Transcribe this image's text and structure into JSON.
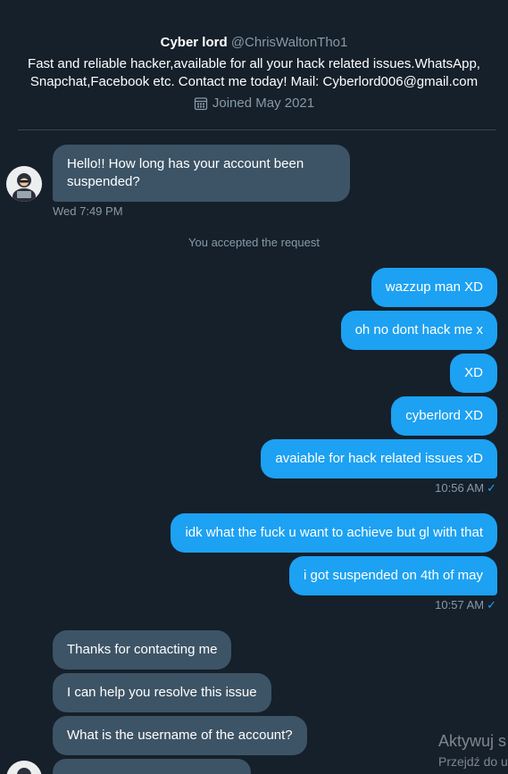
{
  "profile": {
    "name": "Cyber lord",
    "handle": "@ChrisWaltonTho1",
    "bio": "Fast and reliable hacker,available for all your hack related issues.WhatsApp, Snapchat,Facebook etc. Contact me today! Mail: Cyberlord006@gmail.com",
    "joined": "Joined May 2021",
    "joined_icon": "calendar-icon"
  },
  "conversation": {
    "first_message": "Hello!! How long has your account been suspended?",
    "first_time": "Wed 7:49 PM",
    "system_note": "You accepted the request",
    "out_group_1": [
      "wazzup man XD",
      "oh no dont hack me x",
      "XD",
      "cyberlord XD",
      "avaiable for hack related issues xD"
    ],
    "out_group_1_time": "10:56 AM",
    "out_group_2": [
      "idk what the fuck u want to achieve but gl with that",
      "i got suspended on 4th of may"
    ],
    "out_group_2_time": "10:57 AM",
    "in_group_2": [
      "Thanks for contacting me",
      "I can help you resolve this issue",
      "What is the username of the account?"
    ],
    "read_mark": "✓"
  },
  "watermark": {
    "title": "Aktywuj s",
    "subtitle": "Przejdź do u"
  },
  "colors": {
    "background": "#15202b",
    "incoming_bubble": "#3d5466",
    "outgoing_bubble": "#1da1f2",
    "muted_text": "#8899a6"
  }
}
